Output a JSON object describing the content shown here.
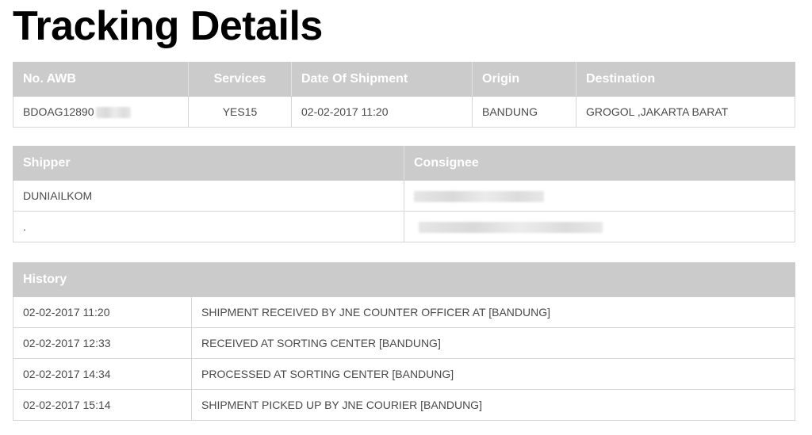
{
  "page": {
    "title": "Tracking Details"
  },
  "shipment": {
    "headers": [
      "No. AWB",
      "Services",
      "Date Of Shipment",
      "Origin",
      "Destination"
    ],
    "awb_visible": "BDOAG12890",
    "service": "YES15",
    "date": "02-02-2017 11:20",
    "origin": "BANDUNG",
    "destination": "GROGOL ,JAKARTA BARAT"
  },
  "parties": {
    "headers": [
      "Shipper",
      "Consignee"
    ],
    "shipper_name": "DUNIAILKOM",
    "shipper_address": "."
  },
  "history": {
    "header": "History",
    "rows": [
      {
        "time": "02-02-2017 11:20",
        "event": "SHIPMENT RECEIVED BY JNE COUNTER OFFICER AT [BANDUNG]"
      },
      {
        "time": "02-02-2017 12:33",
        "event": "RECEIVED AT SORTING CENTER [BANDUNG]"
      },
      {
        "time": "02-02-2017 14:34",
        "event": "PROCESSED AT SORTING CENTER [BANDUNG]"
      },
      {
        "time": "02-02-2017 15:14",
        "event": "SHIPMENT PICKED UP BY JNE COURIER [BANDUNG]"
      }
    ]
  },
  "colors": {
    "header_bg": "#cbcbcb",
    "header_text": "#ffffff",
    "border": "#d6d6d6",
    "body_text": "#4a4a4a"
  }
}
